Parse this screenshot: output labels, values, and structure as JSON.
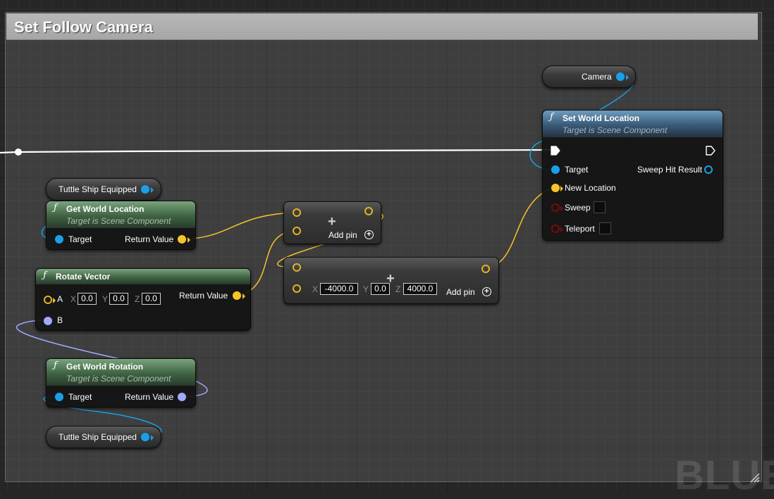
{
  "comment": {
    "title": "Set Follow Camera"
  },
  "watermark": "BLUE",
  "colors": {
    "wire_object": "#1aa0e8",
    "wire_vector": "#f5c528",
    "wire_rotator": "#a0a8ff",
    "wire_exec": "#ffffff",
    "header_pure": "#3e6342",
    "header_impure": "#385a77"
  },
  "nodes": {
    "camera_var": {
      "label": "Camera"
    },
    "ship_var_top": {
      "label": "Tuttle Ship Equipped"
    },
    "ship_var_bottom": {
      "label": "Tuttle Ship Equipped"
    },
    "get_world_location": {
      "title": "Get World Location",
      "subtitle": "Target is Scene Component",
      "pin_target": "Target",
      "pin_return": "Return Value"
    },
    "rotate_vector": {
      "title": "Rotate Vector",
      "pin_a": "A",
      "a_x_label": "X",
      "a_x": "0.0",
      "a_y_label": "Y",
      "a_y": "0.0",
      "a_z_label": "Z",
      "a_z": "0.0",
      "pin_b": "B",
      "pin_return": "Return Value"
    },
    "get_world_rotation": {
      "title": "Get World Rotation",
      "subtitle": "Target is Scene Component",
      "pin_target": "Target",
      "pin_return": "Return Value"
    },
    "add_top": {
      "add_pin": "Add pin"
    },
    "add_bottom": {
      "x_label": "X",
      "x": "-4000.0",
      "y_label": "Y",
      "y": "0.0",
      "z_label": "Z",
      "z": "4000.0",
      "add_pin": "Add pin"
    },
    "set_world_location": {
      "title": "Set World Location",
      "subtitle": "Target is Scene Component",
      "pin_target": "Target",
      "pin_sweep_hit": "Sweep Hit Result",
      "pin_new_location": "New Location",
      "pin_sweep": "Sweep",
      "pin_teleport": "Teleport"
    }
  }
}
